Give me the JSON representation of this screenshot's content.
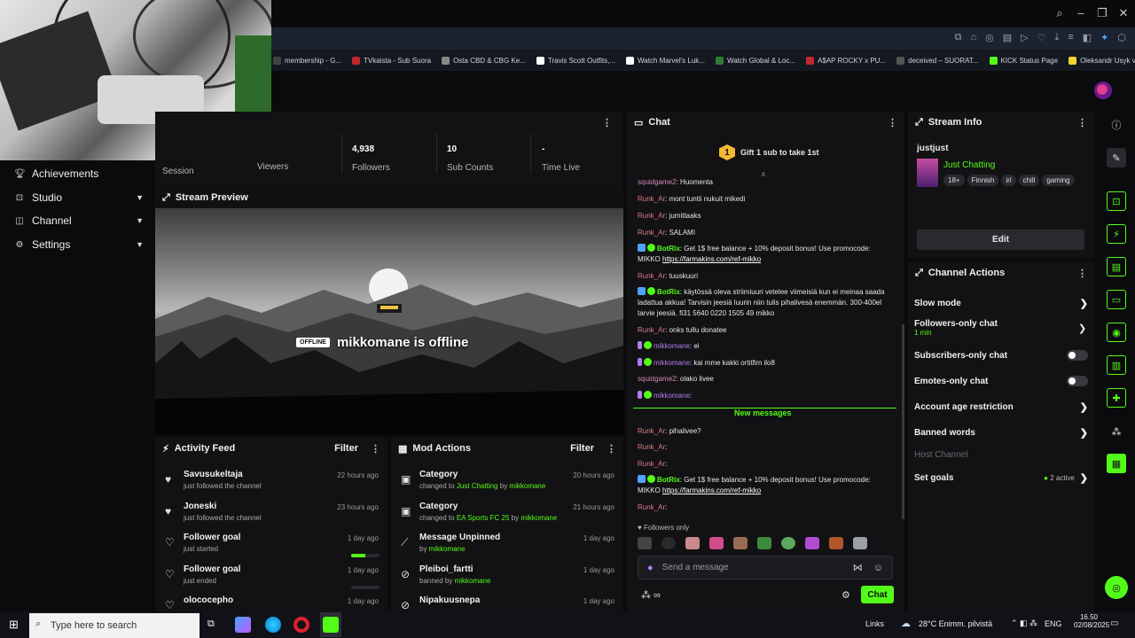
{
  "window": {
    "controls": [
      "search",
      "minimize",
      "maximize",
      "close"
    ]
  },
  "bookmarks": [
    {
      "label": "membership - G...",
      "color": "#444"
    },
    {
      "label": "TVkaista - Sub Suora",
      "color": "#c2272d"
    },
    {
      "label": "Osta CBD & CBG Ke...",
      "color": "#888"
    },
    {
      "label": "Travis Scott Outfits,...",
      "color": "#ffffff"
    },
    {
      "label": "Watch Marvel's Luk...",
      "color": "#ffffff"
    },
    {
      "label": "Watch Global & Loc...",
      "color": "#2e7d32"
    },
    {
      "label": "A$AP ROCKY x PU...",
      "color": "#c2272d"
    },
    {
      "label": "deceived – SUORAT...",
      "color": "#555"
    },
    {
      "label": "KICK Status Page",
      "color": "#53fc18"
    },
    {
      "label": "Oleksandr Usyk vs D...",
      "color": "#f3d230"
    }
  ],
  "sidebar": {
    "items": [
      {
        "label": "Achievements",
        "icon": "trophy-icon"
      },
      {
        "label": "Studio",
        "icon": "studio-icon"
      },
      {
        "label": "Channel",
        "icon": "channel-icon"
      },
      {
        "label": "Settings",
        "icon": "gear-icon"
      }
    ]
  },
  "stats": {
    "session_label": "Session",
    "viewers_label": "Viewers",
    "followers_value": "4,938",
    "followers_label": "Followers",
    "subs_value": "10",
    "subs_label": "Sub Counts",
    "time_value": "-",
    "time_label": "Time Live"
  },
  "preview": {
    "title": "Stream Preview",
    "offline_tag": "OFFLINE",
    "offline_text": "mikkomane is offline"
  },
  "activity": {
    "title": "Activity Feed",
    "filter": "Filter",
    "rows": [
      {
        "name": "Savusukeltaja",
        "sub": "just followed the channel",
        "time": "22 hours ago"
      },
      {
        "name": "Joneski",
        "sub": "just followed the channel",
        "time": "23 hours ago"
      },
      {
        "name": "Follower goal",
        "sub": "just started",
        "time": "1 day ago",
        "progress": 0.5
      },
      {
        "name": "Follower goal",
        "sub": "just ended",
        "time": "1 day ago",
        "progress": 0
      },
      {
        "name": "olococepho",
        "sub": "",
        "time": "1 day ago"
      }
    ]
  },
  "mod": {
    "title": "Mod Actions",
    "filter": "Filter",
    "rows": [
      {
        "name": "Category",
        "pre": "changed to ",
        "hl": "Just Chatting",
        "mid": " by ",
        "user": "mikkomane",
        "time": "20 hours ago"
      },
      {
        "name": "Category",
        "pre": "changed to ",
        "hl": "EA Sports FC 25",
        "mid": " by ",
        "user": "mikkomane",
        "time": "21 hours ago"
      },
      {
        "name": "Message Unpinned",
        "pre": "by ",
        "hl": "",
        "mid": "",
        "user": "mikkomane",
        "time": "1 day ago"
      },
      {
        "name": "Pleiboi_fartti",
        "pre": "banned by ",
        "hl": "",
        "mid": "",
        "user": "mikkomane",
        "time": "1 day ago"
      },
      {
        "name": "Nipakuusnepa",
        "pre": "",
        "hl": "",
        "mid": "",
        "user": "",
        "time": "1 day ago"
      }
    ]
  },
  "chat": {
    "title": "Chat",
    "pinned": "Gift 1 sub to take 1st",
    "pinned_count": "1",
    "messages": [
      {
        "user": "squidgame2",
        "cls": "u-s",
        "text": ": Huomenta"
      },
      {
        "user": "Runk_Ar",
        "cls": "u-r",
        "text": ": mont tuntii nukuit mikedi"
      },
      {
        "user": "Runk_Ar",
        "cls": "u-r",
        "text": ": jumittaaks"
      },
      {
        "user": "Runk_Ar",
        "cls": "u-r",
        "text": ": SALAMI"
      },
      {
        "user": "BotRix",
        "cls": "u-g",
        "text": ": Get 1$ free balance + 10% deposit bonus! Use promocode: MIKKO",
        "link": "https://farmakins.com/ref-mikko"
      },
      {
        "user": "Runk_Ar",
        "cls": "u-r",
        "text": ": tuuskuuri"
      },
      {
        "user": "BotRix",
        "cls": "u-g",
        "text": ": käytössä oleva striimiuuri vetelee viimeisiä kun ei meinaa saada ladattua akkua! Tarvisin jeesiä luurin niin tulis pihalivesä enemmän. 300-400el tarvie jeesiä. fi31 5640 0220 1505 49 mikko"
      },
      {
        "user": "Runk_Ar",
        "cls": "u-r",
        "text": ": onks tullu donatee"
      },
      {
        "user": "mikkomane",
        "cls": "u-p",
        "text": ": ei"
      },
      {
        "user": "mikkomane",
        "cls": "u-p",
        "text": ": kai mme kakki ortitfim ilo8"
      },
      {
        "user": "squidgame2",
        "cls": "u-s",
        "text": ": olako livee"
      },
      {
        "user": "mikkomane",
        "cls": "u-p",
        "text": ": "
      }
    ],
    "new_messages_label": "New messages",
    "new_messages": [
      {
        "user": "Runk_Ar",
        "cls": "u-r",
        "text": ": pihalivee?"
      },
      {
        "user": "Runk_Ar",
        "cls": "u-r",
        "text": ": "
      },
      {
        "user": "Runk_Ar",
        "cls": "u-r",
        "text": ": "
      },
      {
        "user": "BotRix",
        "cls": "u-g",
        "text": ": Get 1$ free balance + 10% deposit bonus! Use promocode: MIKKO",
        "link": "https://farmakins.com/ref-mikko"
      },
      {
        "user": "Runk_Ar",
        "cls": "u-r",
        "text": ": "
      }
    ],
    "followers_only": "Followers only",
    "input_placeholder": "Send a message",
    "send_label": "Chat"
  },
  "stream_info": {
    "title": "Stream Info",
    "stream_title": "justjust",
    "category": "Just Chatting",
    "tags": [
      "18+",
      "Finnish",
      "irl",
      "chill",
      "gaming"
    ],
    "edit_label": "Edit"
  },
  "channel_actions": {
    "title": "Channel Actions",
    "slow_mode": "Slow mode",
    "followers_only": "Followers-only chat",
    "followers_only_value": "1 min",
    "subs_only": "Subscribers-only chat",
    "emotes_only": "Emotes-only chat",
    "account_age": "Account age restriction",
    "banned_words": "Banned words",
    "host_channel": "Host Channel",
    "set_goals": "Set goals",
    "goals_active": "2 active"
  },
  "taskbar": {
    "search_placeholder": "Type here to search",
    "links": "Links",
    "weather": "28°C  Enimm. pilvistä",
    "lang": "ENG",
    "time": "16.50",
    "date": "02/08/2025"
  },
  "colors": {
    "accent": "#53fc18",
    "panel": "#121214",
    "bg": "#0b0b0d"
  }
}
